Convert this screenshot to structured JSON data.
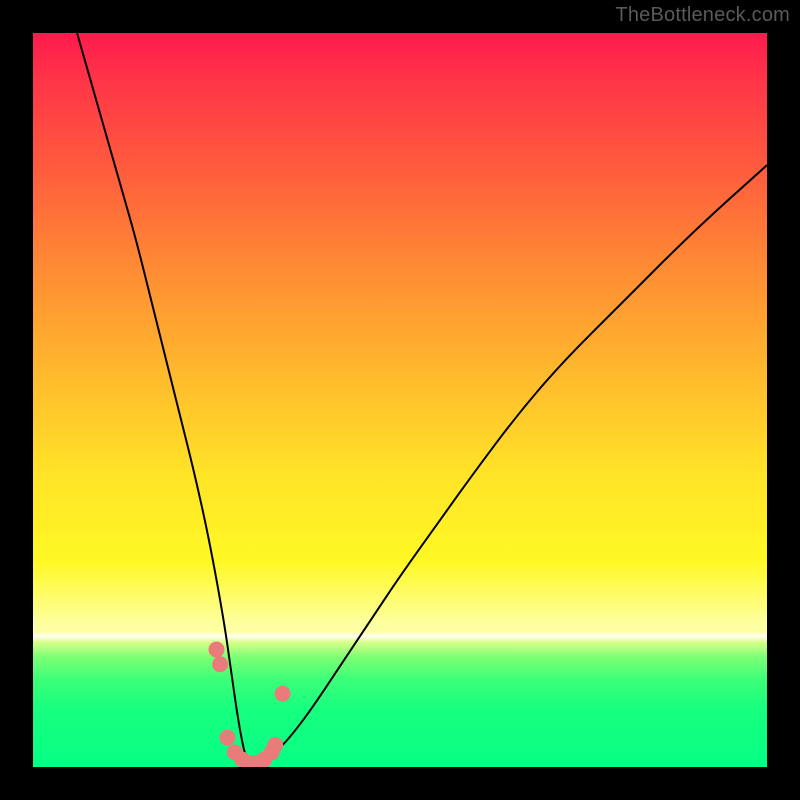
{
  "watermark": "TheBottleneck.com",
  "chart_data": {
    "type": "line",
    "title": "",
    "xlabel": "",
    "ylabel": "",
    "xlim": [
      0,
      100
    ],
    "ylim": [
      0,
      100
    ],
    "series": [
      {
        "name": "bottleneck-curve",
        "x": [
          6,
          8,
          10,
          12,
          14,
          16,
          18,
          20,
          22,
          24,
          26,
          27,
          28,
          29,
          30,
          31,
          32,
          33,
          35,
          38,
          42,
          46,
          50,
          55,
          60,
          66,
          72,
          80,
          90,
          100
        ],
        "values": [
          100,
          93,
          86,
          79,
          72,
          64,
          56,
          48,
          40,
          31,
          20,
          13,
          6,
          1,
          0,
          0,
          1,
          2,
          4,
          8,
          14,
          20,
          26,
          33,
          40,
          48,
          55,
          63,
          73,
          82
        ]
      }
    ],
    "markers": {
      "name": "highlight-dots",
      "color": "#e97b7b",
      "points": [
        {
          "x": 25.0,
          "y": 16
        },
        {
          "x": 25.5,
          "y": 14
        },
        {
          "x": 26.5,
          "y": 4
        },
        {
          "x": 27.5,
          "y": 2
        },
        {
          "x": 28.5,
          "y": 1
        },
        {
          "x": 29.5,
          "y": 0.5
        },
        {
          "x": 30.5,
          "y": 0.5
        },
        {
          "x": 31.5,
          "y": 1
        },
        {
          "x": 32.5,
          "y": 2
        },
        {
          "x": 33.0,
          "y": 3
        },
        {
          "x": 34.0,
          "y": 10
        }
      ]
    }
  }
}
